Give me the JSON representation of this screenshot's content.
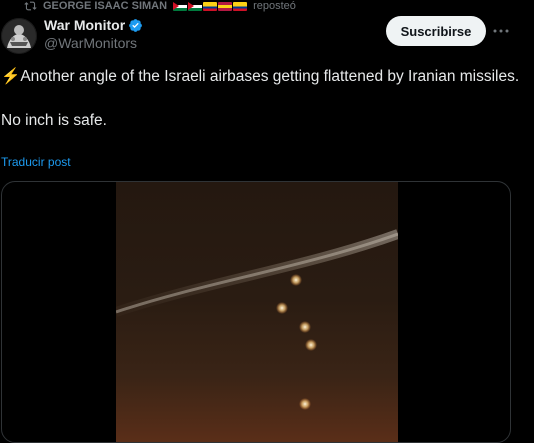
{
  "repost": {
    "user": "GEORGE ISAAC SIMAN",
    "suffix": "reposteó",
    "icon": "repost-icon",
    "flags": [
      "#d6001c",
      "#d6001c",
      "#fcd116",
      "#b31942",
      "#fcd116"
    ]
  },
  "author": {
    "name": "War Monitor",
    "handle": "@WarMonitors",
    "verified_color": "#1d9bf0",
    "avatar_icon": "avatar-image"
  },
  "subscribe_label": "Suscribirse",
  "more_icon": "more-options-icon",
  "tweet": {
    "emoji": "⚡",
    "line1": "Another angle of the Israeli airbases getting flattened by Iranian missiles.",
    "line2": "No inch is safe."
  },
  "translate_label": "Traducir post",
  "colors": {
    "background": "#000000",
    "text": "#e7e9ea",
    "muted": "#71767b",
    "link": "#1d9bf0"
  }
}
